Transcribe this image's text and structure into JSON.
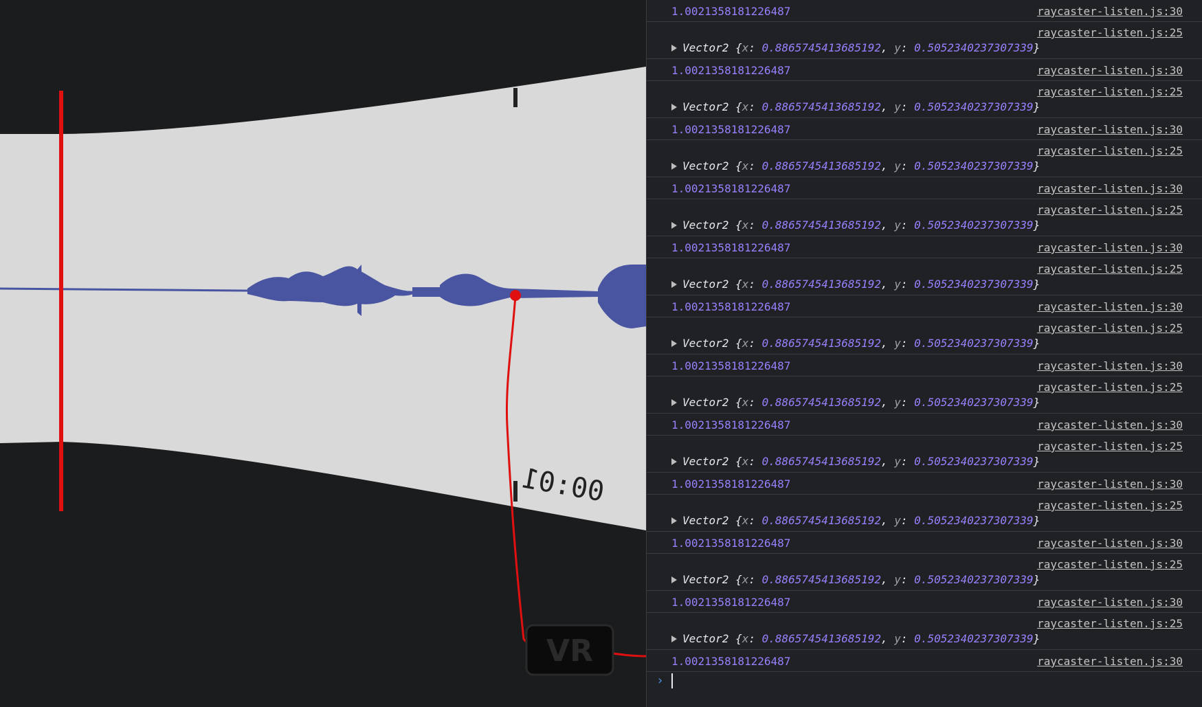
{
  "scene": {
    "timecode": "00:01",
    "vr_button_label": "VR",
    "colors": {
      "background": "#1b1c1e",
      "panel": "#d9d9d9",
      "waveform": "#4a55a2",
      "annotation": "#e01010"
    }
  },
  "console": {
    "rows": [
      {
        "type": "num",
        "value": "1.0021358181226487",
        "source": "raycaster-listen.js:30"
      },
      {
        "type": "obj",
        "source": "raycaster-listen.js:25",
        "cls": "Vector2",
        "x": "0.8865745413685192",
        "y": "0.5052340237307339"
      },
      {
        "type": "num",
        "value": "1.0021358181226487",
        "source": "raycaster-listen.js:30"
      },
      {
        "type": "obj",
        "source": "raycaster-listen.js:25",
        "cls": "Vector2",
        "x": "0.8865745413685192",
        "y": "0.5052340237307339"
      },
      {
        "type": "num",
        "value": "1.0021358181226487",
        "source": "raycaster-listen.js:30"
      },
      {
        "type": "obj",
        "source": "raycaster-listen.js:25",
        "cls": "Vector2",
        "x": "0.8865745413685192",
        "y": "0.5052340237307339"
      },
      {
        "type": "num",
        "value": "1.0021358181226487",
        "source": "raycaster-listen.js:30"
      },
      {
        "type": "obj",
        "source": "raycaster-listen.js:25",
        "cls": "Vector2",
        "x": "0.8865745413685192",
        "y": "0.5052340237307339"
      },
      {
        "type": "num",
        "value": "1.0021358181226487",
        "source": "raycaster-listen.js:30"
      },
      {
        "type": "obj",
        "source": "raycaster-listen.js:25",
        "cls": "Vector2",
        "x": "0.8865745413685192",
        "y": "0.5052340237307339"
      },
      {
        "type": "num",
        "value": "1.0021358181226487",
        "source": "raycaster-listen.js:30"
      },
      {
        "type": "obj",
        "source": "raycaster-listen.js:25",
        "cls": "Vector2",
        "x": "0.8865745413685192",
        "y": "0.5052340237307339"
      },
      {
        "type": "num",
        "value": "1.0021358181226487",
        "source": "raycaster-listen.js:30"
      },
      {
        "type": "obj",
        "source": "raycaster-listen.js:25",
        "cls": "Vector2",
        "x": "0.8865745413685192",
        "y": "0.5052340237307339"
      },
      {
        "type": "num",
        "value": "1.0021358181226487",
        "source": "raycaster-listen.js:30"
      },
      {
        "type": "obj",
        "source": "raycaster-listen.js:25",
        "cls": "Vector2",
        "x": "0.8865745413685192",
        "y": "0.5052340237307339"
      },
      {
        "type": "num",
        "value": "1.0021358181226487",
        "source": "raycaster-listen.js:30"
      },
      {
        "type": "obj",
        "source": "raycaster-listen.js:25",
        "cls": "Vector2",
        "x": "0.8865745413685192",
        "y": "0.5052340237307339"
      },
      {
        "type": "num",
        "value": "1.0021358181226487",
        "source": "raycaster-listen.js:30"
      },
      {
        "type": "obj",
        "source": "raycaster-listen.js:25",
        "cls": "Vector2",
        "x": "0.8865745413685192",
        "y": "0.5052340237307339"
      },
      {
        "type": "num",
        "value": "1.0021358181226487",
        "source": "raycaster-listen.js:30"
      },
      {
        "type": "obj",
        "source": "raycaster-listen.js:25",
        "cls": "Vector2",
        "x": "0.8865745413685192",
        "y": "0.5052340237307339"
      },
      {
        "type": "num",
        "value": "1.0021358181226487",
        "source": "raycaster-listen.js:30"
      }
    ],
    "prompt_symbol": "›"
  }
}
